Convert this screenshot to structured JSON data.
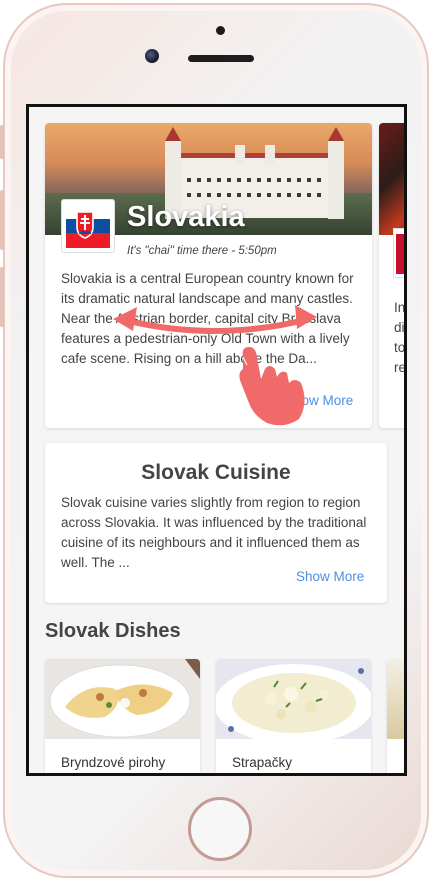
{
  "country": {
    "name": "Slovakia",
    "time_text": "It's \"chai\" time there - 5:50pm",
    "description": "Slovakia is a central European country known for its dramatic natural landscape and many castles. Near the Austrian border, capital city Bratislava features a pedestrian-only Old Town with a lively cafe scene. Rising on a hill above the Da...",
    "show_more": "Show More"
  },
  "next_card": {
    "text_preview": "In\ndi\nto\nre"
  },
  "cuisine": {
    "title": "Slovak Cuisine",
    "description": "Slovak cuisine varies slightly from region to region across Slovakia. It was influenced by the traditional cuisine of its neighbours and it influenced them as well. The ...",
    "show_more": "Show More"
  },
  "dishes": {
    "heading": "Slovak Dishes",
    "items": [
      {
        "name": "Bryndzové pirohy"
      },
      {
        "name": "Strapačky"
      }
    ]
  },
  "colors": {
    "accent": "#4a90e2",
    "gesture": "#f06a6a",
    "flag_white": "#ffffff",
    "flag_blue": "#0b4ea2",
    "flag_red": "#ee1c25"
  },
  "icons": {
    "gesture": "swipe-hand-icon"
  }
}
